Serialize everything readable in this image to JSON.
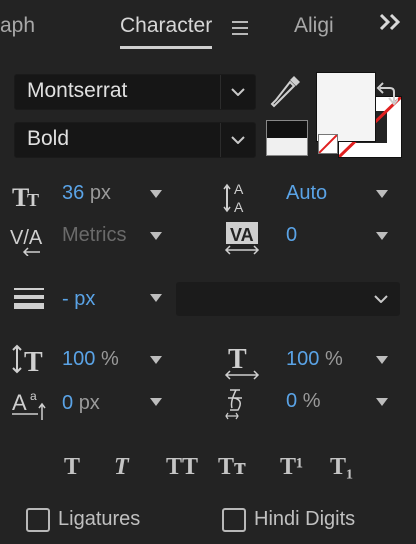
{
  "tabs": {
    "left_partial": "aph",
    "active": "Character",
    "right_partial": "Aligi"
  },
  "font": {
    "family": "Montserrat",
    "style": "Bold"
  },
  "metrics": {
    "font_size_value": "36",
    "font_size_unit": "px",
    "line_spacing": "Auto",
    "kerning": "Metrics",
    "tracking": "0",
    "stroke_width_value": "-",
    "stroke_width_unit": "px",
    "vertical_scale": "100",
    "vertical_scale_unit": "%",
    "horizontal_scale": "100",
    "horizontal_scale_unit": "%",
    "baseline_shift_value": "0",
    "baseline_shift_unit": "px",
    "tsume_value": "0",
    "tsume_unit": "%"
  },
  "style_buttons": [
    "T",
    "T",
    "TT",
    "Tт",
    "T¹",
    "T₁"
  ],
  "options": {
    "ligatures": "Ligatures",
    "hindi_digits": "Hindi Digits"
  },
  "colors": {
    "panel_bg": "#232323",
    "accent_blue": "#5aa3e6",
    "fill_color": "#f4f4f4",
    "stroke_color": "#ffffff",
    "no_color_slash": "#e02020"
  },
  "icons": [
    "menu-icon",
    "overflow-chevrons-icon",
    "eyedropper-icon",
    "swap-colors-icon",
    "font-size-icon",
    "line-spacing-icon",
    "kerning-icon",
    "tracking-icon",
    "stroke-width-icon",
    "vertical-scale-icon",
    "horizontal-scale-icon",
    "baseline-shift-icon",
    "tsume-icon"
  ]
}
